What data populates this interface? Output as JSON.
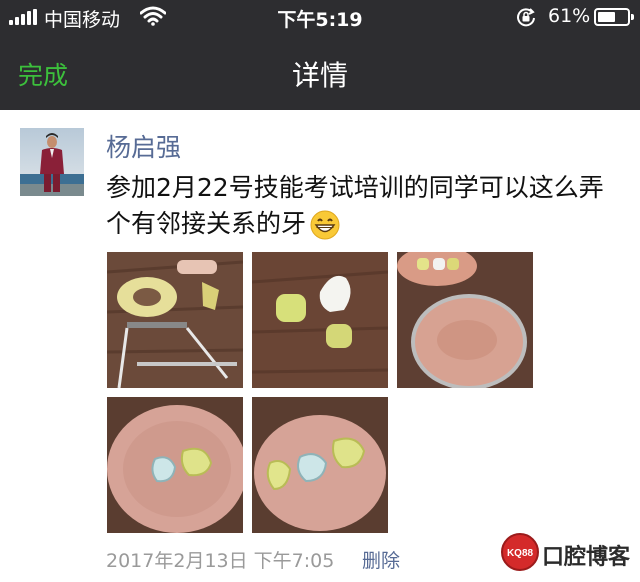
{
  "status_bar": {
    "carrier": "中国移动",
    "time": "下午5:19",
    "battery_percent": "61%",
    "battery_level": 0.61,
    "icons": [
      "signal-icon",
      "wifi-icon",
      "rotation-lock-icon",
      "battery-icon"
    ]
  },
  "nav": {
    "done_label": "完成",
    "title": "详情"
  },
  "post": {
    "author": "杨启强",
    "text": "参加2月22号技能考试培训的同学可以这么弄个有邻接关系的牙",
    "emoji": "grinning-face-icon",
    "photo_count": 5,
    "timestamp": "2017年2月13日 下午7:05",
    "delete_label": "删除"
  },
  "watermark": {
    "badge": "KQ88",
    "text": "口腔博客"
  },
  "colors": {
    "header_bg": "#2d2d30",
    "accent_green": "#3cc03c",
    "link_blue": "#576b95",
    "meta_gray": "#9a9a9a"
  }
}
